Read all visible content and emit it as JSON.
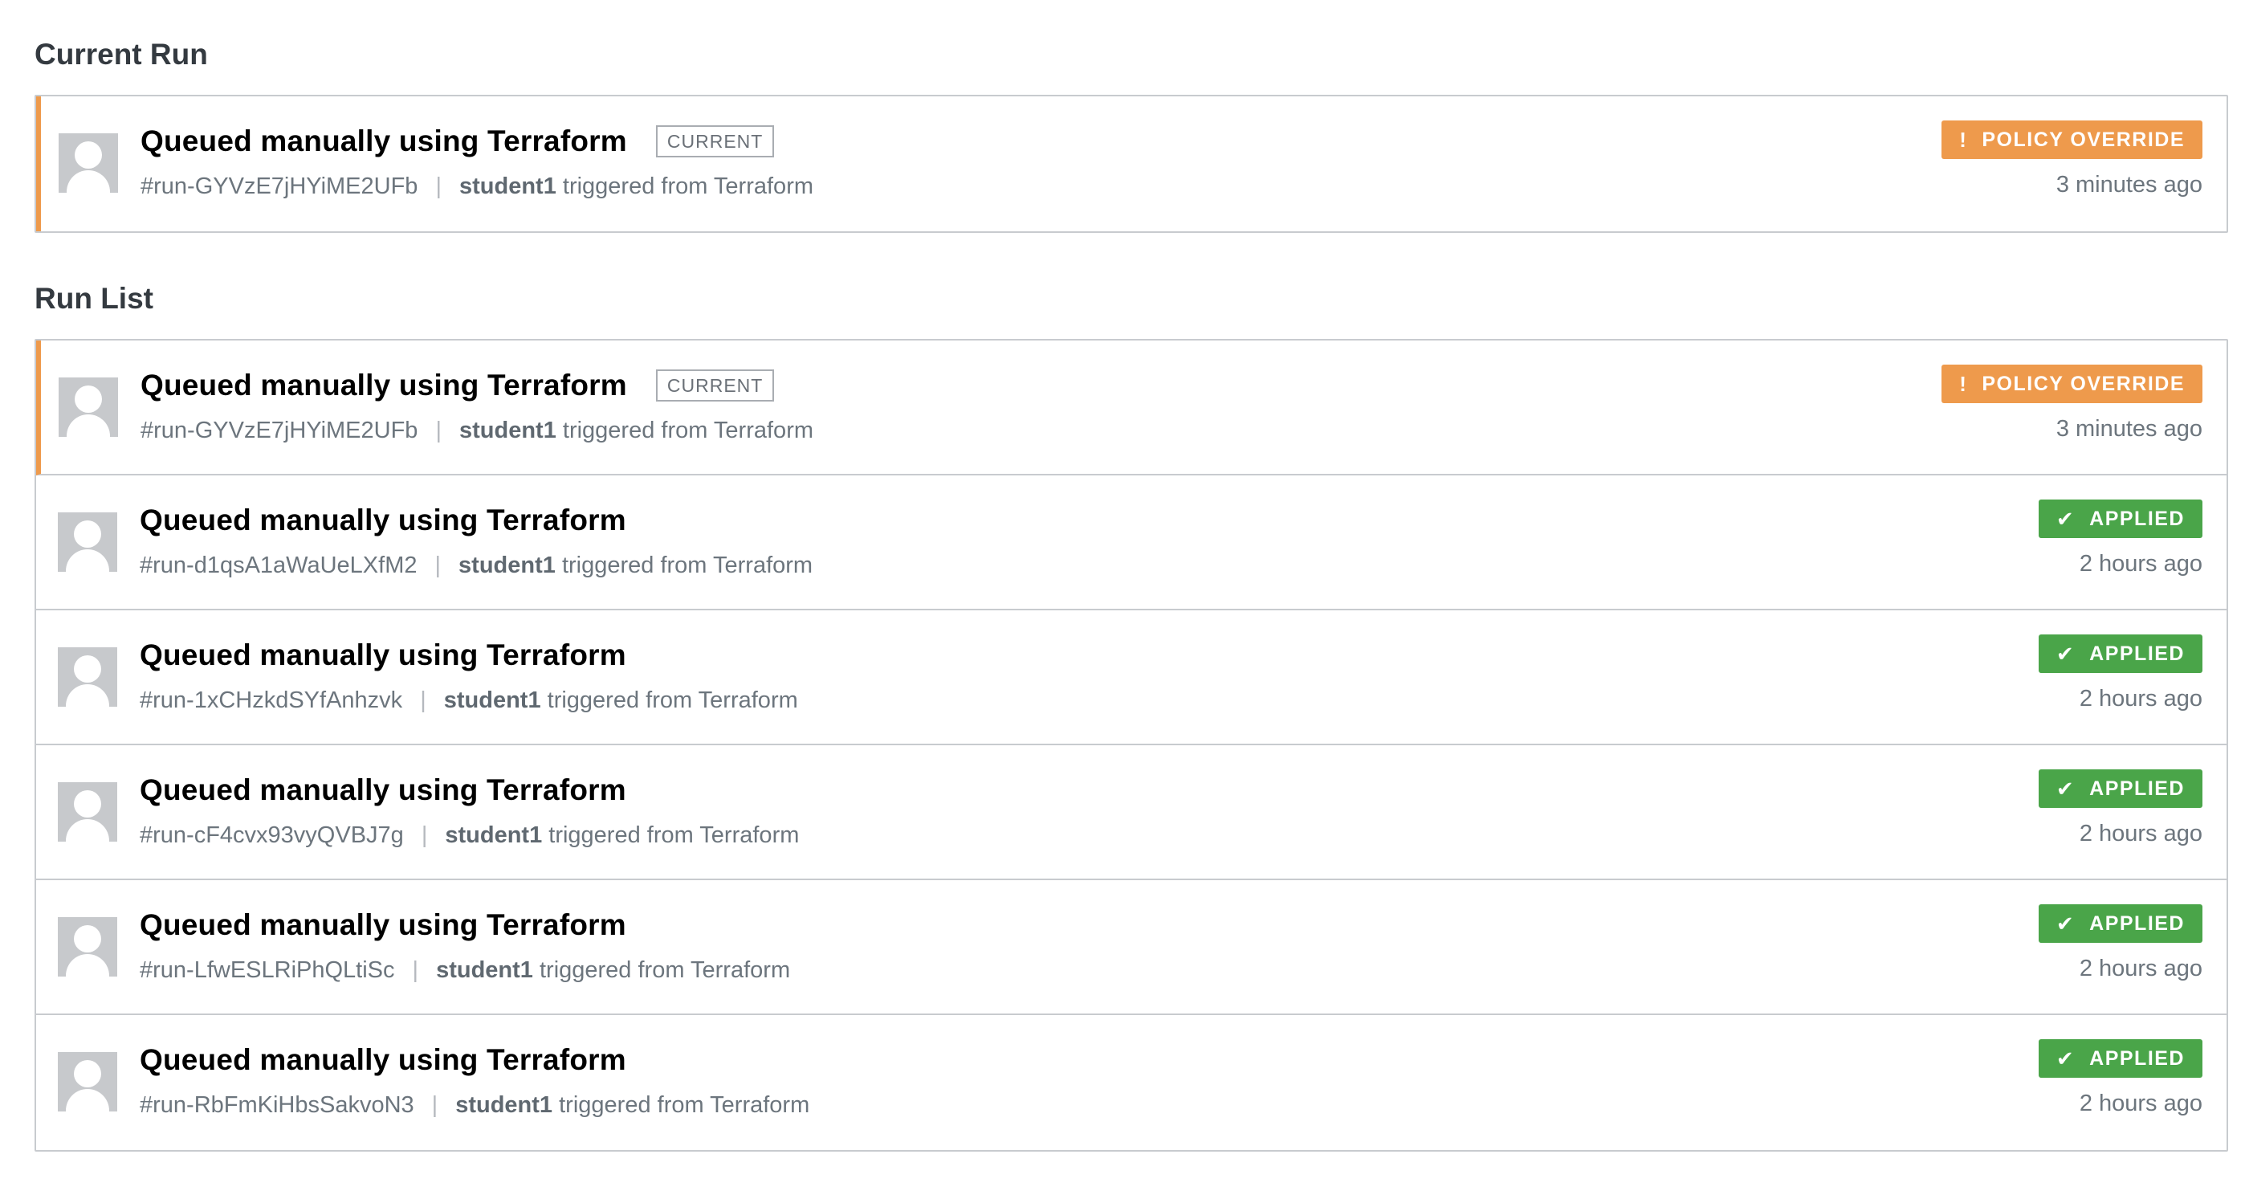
{
  "current_run_section": {
    "title": "Current Run",
    "run": {
      "title": "Queued manually using Terraform",
      "tag": "CURRENT",
      "run_id": "#run-GYVzE7jHYiME2UFb",
      "separator": "|",
      "user": "student1",
      "trigger_text": " triggered from Terraform",
      "badge": {
        "label": "POLICY OVERRIDE",
        "icon": "exclamation-icon",
        "glyph": "!",
        "color": "#ee9a4c"
      },
      "time": "3 minutes ago"
    }
  },
  "run_list_section": {
    "title": "Run List",
    "runs": [
      {
        "title": "Queued manually using Terraform",
        "tag": "CURRENT",
        "run_id": "#run-GYVzE7jHYiME2UFb",
        "separator": "|",
        "user": "student1",
        "trigger_text": " triggered from Terraform",
        "badge": {
          "label": "POLICY OVERRIDE",
          "icon": "exclamation-icon",
          "glyph": "!",
          "color": "#ee9a4c"
        },
        "time": "3 minutes ago"
      },
      {
        "title": "Queued manually using Terraform",
        "run_id": "#run-d1qsA1aWaUeLXfM2",
        "separator": "|",
        "user": "student1",
        "trigger_text": " triggered from Terraform",
        "badge": {
          "label": "APPLIED",
          "icon": "checkmark-icon",
          "glyph": "✔",
          "color": "#4aa549"
        },
        "time": "2 hours ago"
      },
      {
        "title": "Queued manually using Terraform",
        "run_id": "#run-1xCHzkdSYfAnhzvk",
        "separator": "|",
        "user": "student1",
        "trigger_text": " triggered from Terraform",
        "badge": {
          "label": "APPLIED",
          "icon": "checkmark-icon",
          "glyph": "✔",
          "color": "#4aa549"
        },
        "time": "2 hours ago"
      },
      {
        "title": "Queued manually using Terraform",
        "run_id": "#run-cF4cvx93vyQVBJ7g",
        "separator": "|",
        "user": "student1",
        "trigger_text": " triggered from Terraform",
        "badge": {
          "label": "APPLIED",
          "icon": "checkmark-icon",
          "glyph": "✔",
          "color": "#4aa549"
        },
        "time": "2 hours ago"
      },
      {
        "title": "Queued manually using Terraform",
        "run_id": "#run-LfwESLRiPhQLtiSc",
        "separator": "|",
        "user": "student1",
        "trigger_text": " triggered from Terraform",
        "badge": {
          "label": "APPLIED",
          "icon": "checkmark-icon",
          "glyph": "✔",
          "color": "#4aa549"
        },
        "time": "2 hours ago"
      },
      {
        "title": "Queued manually using Terraform",
        "run_id": "#run-RbFmKiHbsSakvoN3",
        "separator": "|",
        "user": "student1",
        "trigger_text": " triggered from Terraform",
        "badge": {
          "label": "APPLIED",
          "icon": "checkmark-icon",
          "glyph": "✔",
          "color": "#4aa549"
        },
        "time": "2 hours ago"
      }
    ]
  }
}
